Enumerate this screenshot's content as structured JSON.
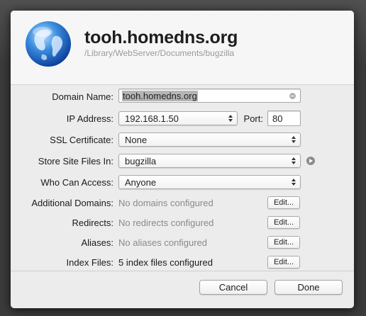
{
  "header": {
    "title": "tooh.homedns.org",
    "path": "/Library/WebServer/Documents/bugzilla"
  },
  "form": {
    "domain_name": {
      "label": "Domain Name:",
      "value": "tooh.homedns.org"
    },
    "ip_address": {
      "label": "IP Address:",
      "value": "192.168.1.50"
    },
    "port": {
      "label": "Port:",
      "value": "80"
    },
    "ssl_certificate": {
      "label": "SSL Certificate:",
      "value": "None"
    },
    "store_site_files": {
      "label": "Store Site Files In:",
      "value": "bugzilla"
    },
    "who_can_access": {
      "label": "Who Can Access:",
      "value": "Anyone"
    },
    "additional_domains": {
      "label": "Additional Domains:",
      "value": "No domains configured",
      "button": "Edit..."
    },
    "redirects": {
      "label": "Redirects:",
      "value": "No redirects configured",
      "button": "Edit..."
    },
    "aliases": {
      "label": "Aliases:",
      "value": "No aliases configured",
      "button": "Edit..."
    },
    "index_files": {
      "label": "Index Files:",
      "value": "5 index files configured",
      "button": "Edit..."
    }
  },
  "buttons": {
    "cancel": "Cancel",
    "done": "Done"
  },
  "icons": {
    "header": "globe-icon",
    "clear": "clear-field-icon",
    "popup": "up-down-arrows-icon",
    "reveal": "reveal-arrow-icon"
  },
  "colors": {
    "placeholder_text": "#8a8a8a",
    "selection": "#b5b5b5"
  }
}
